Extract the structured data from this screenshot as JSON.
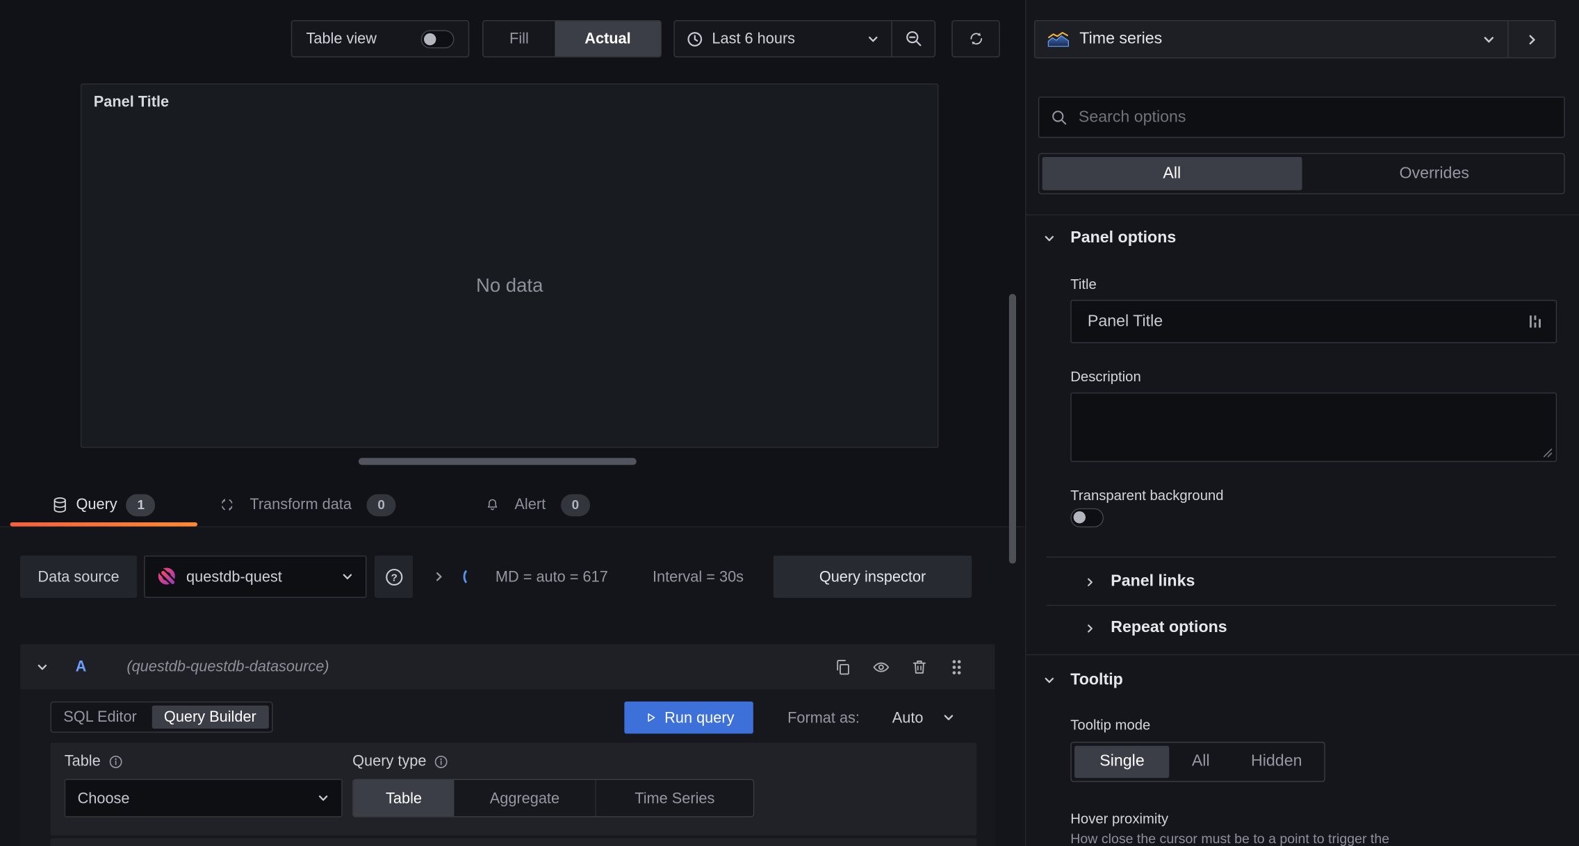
{
  "colors": {
    "canvas_bg": "#111217",
    "pane_bg": "#15161c",
    "panel_bg": "#181b1f",
    "accent_tab_gradient": [
      "#f55f3e",
      "#ff8833"
    ],
    "primary_button_blue": "#3d71d9",
    "ref_id_blue": "#6e9fff",
    "spinner_blue": "#5794f2",
    "questdb_pink": "#ef476f",
    "questdb_purple": "#a43ab8",
    "text_primary": "#ccccdc",
    "text_secondary": "#8e909c"
  },
  "icons": [
    "table-view-toggle",
    "clock-icon",
    "chevron-down-icon",
    "zoom-out-icon",
    "refresh-icon",
    "timeseries-viz-icon",
    "chevron-right-icon",
    "search-icon",
    "database-icon",
    "transform-icon",
    "bell-icon",
    "questdb-logo-icon",
    "help-circle-icon",
    "copy-icon",
    "eye-icon",
    "trash-icon",
    "drag-handle-icon",
    "info-circle-icon",
    "play-icon",
    "suggestion-bars-icon",
    "resize-corner-icon"
  ],
  "toolbar": {
    "table_view_label": "Table view",
    "view_modes": [
      "Fill",
      "Actual"
    ],
    "view_mode_selected": "Actual",
    "time_range": "Last 6 hours"
  },
  "panel_preview": {
    "title": "Panel Title",
    "no_data": "No data"
  },
  "tabs": [
    {
      "label": "Query",
      "badge": "1"
    },
    {
      "label": "Transform data",
      "badge": "0"
    },
    {
      "label": "Alert",
      "badge": "0"
    }
  ],
  "query_toolbar": {
    "datasource_label": "Data source",
    "datasource_value": "questdb-quest",
    "md_stat": "MD = auto = 617",
    "interval_stat": "Interval = 30s",
    "query_inspector": "Query inspector"
  },
  "query_row": {
    "ref_id": "A",
    "datasource_hint": "(questdb-questdb-datasource)",
    "mode_sql": "SQL Editor",
    "mode_builder": "Query Builder",
    "mode_selected": "Query Builder",
    "run_query": "Run query",
    "format_as_label": "Format as:",
    "format_as_value": "Auto",
    "table_label": "Table",
    "table_value": "Choose",
    "query_type_label": "Query type",
    "query_types": [
      "Table",
      "Aggregate",
      "Time Series"
    ],
    "query_type_selected": "Table"
  },
  "options_pane": {
    "viz_name": "Time series",
    "search_placeholder": "Search options",
    "filter_all": "All",
    "filter_overrides": "Overrides",
    "filter_selected": "All",
    "panel_options": {
      "header": "Panel options",
      "title_label": "Title",
      "title_value": "Panel Title",
      "description_label": "Description",
      "transparent_label": "Transparent background",
      "panel_links": "Panel links",
      "repeat_options": "Repeat options"
    },
    "tooltip": {
      "header": "Tooltip",
      "mode_label": "Tooltip mode",
      "modes": [
        "Single",
        "All",
        "Hidden"
      ],
      "mode_selected": "Single",
      "hover_label": "Hover proximity",
      "hover_help": "How close the cursor must be to a point to trigger the"
    }
  }
}
